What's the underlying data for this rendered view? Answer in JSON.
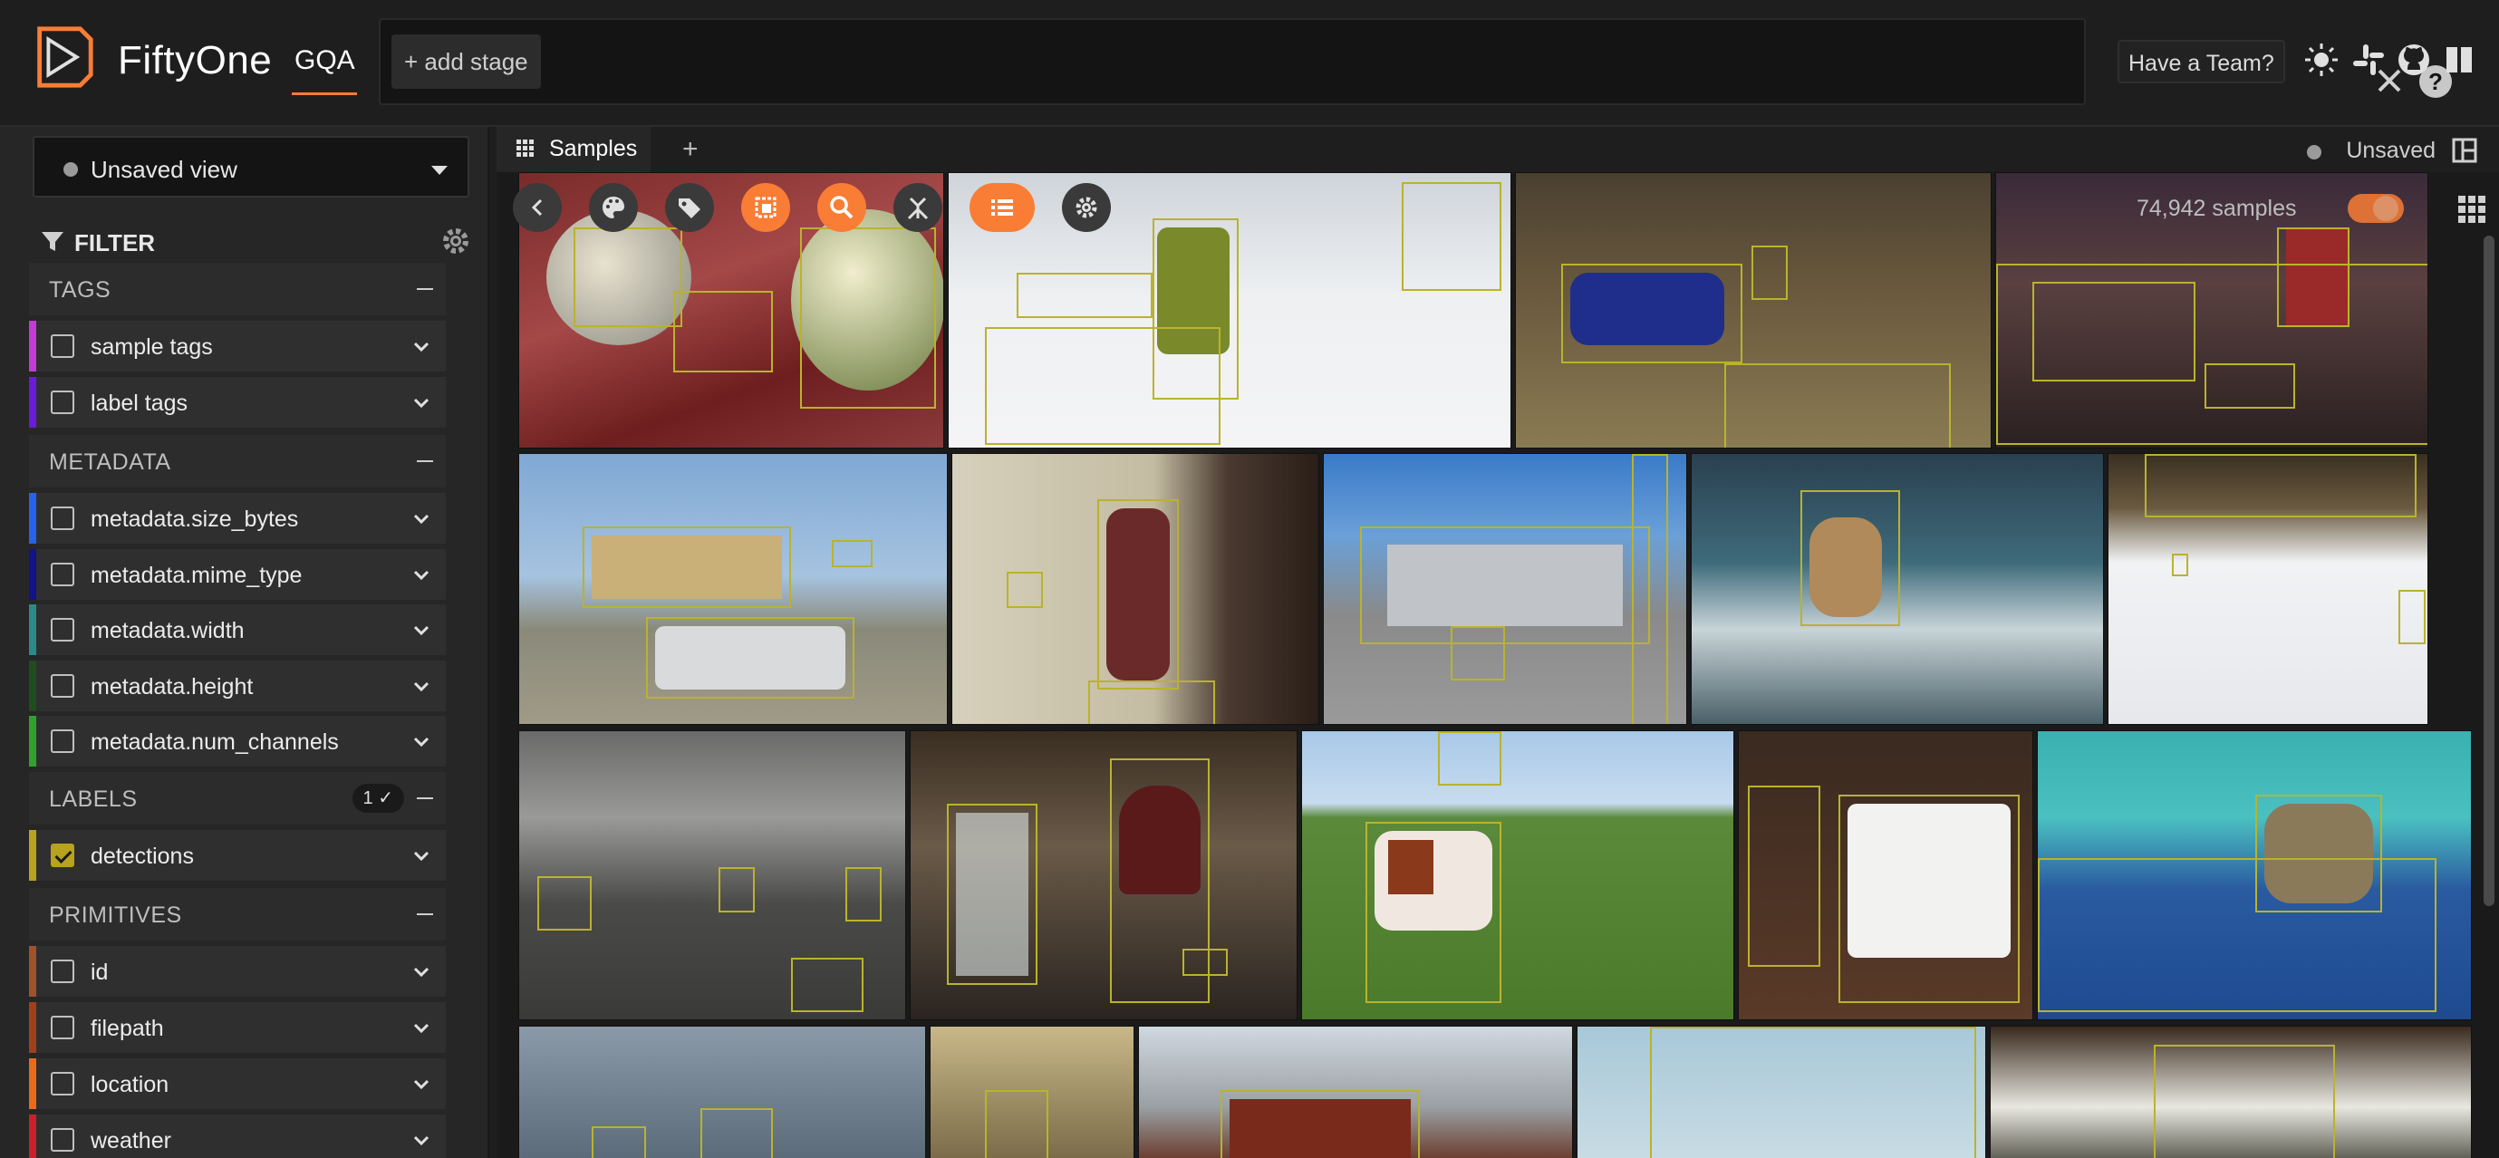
{
  "header": {
    "brand": "FiftyOne",
    "dataset": "GQA",
    "add_stage": "+ add stage",
    "team_button": "Have a Team?",
    "icons": [
      "close-icon",
      "help-icon",
      "theme-sun-icon",
      "slack-icon",
      "github-icon",
      "docs-book-icon"
    ]
  },
  "sidebar": {
    "view_select": "Unsaved view",
    "filter_label": "FILTER",
    "sections": {
      "tags": "TAGS",
      "metadata": "METADATA",
      "labels": "LABELS",
      "primitives": "PRIMITIVES"
    },
    "labels_count": "1",
    "fields": {
      "sample_tags": "sample tags",
      "label_tags": "label tags",
      "size_bytes": "metadata.size_bytes",
      "mime_type": "metadata.mime_type",
      "width": "metadata.width",
      "height": "metadata.height",
      "num_channels": "metadata.num_channels",
      "detections": "detections",
      "id": "id",
      "filepath": "filepath",
      "location": "location",
      "weather": "weather"
    },
    "field_colors": {
      "sample_tags": "#c33ad6",
      "label_tags": "#6a1bd8",
      "size_bytes": "#2563eb",
      "mime_type": "#12128a",
      "width": "#2a8a8a",
      "height": "#1e4d1e",
      "num_channels": "#2fa12f",
      "detections": "#b7a31d",
      "id": "#a0522d",
      "filepath": "#a0401a",
      "location": "#ea6a1b",
      "weather": "#c9202a"
    }
  },
  "main": {
    "tab_label": "Samples",
    "tab_add": "+",
    "unsaved": "Unsaved",
    "samples_count": "74,942 samples",
    "accent": "#f97d35",
    "box_color": "#b9b32d"
  }
}
